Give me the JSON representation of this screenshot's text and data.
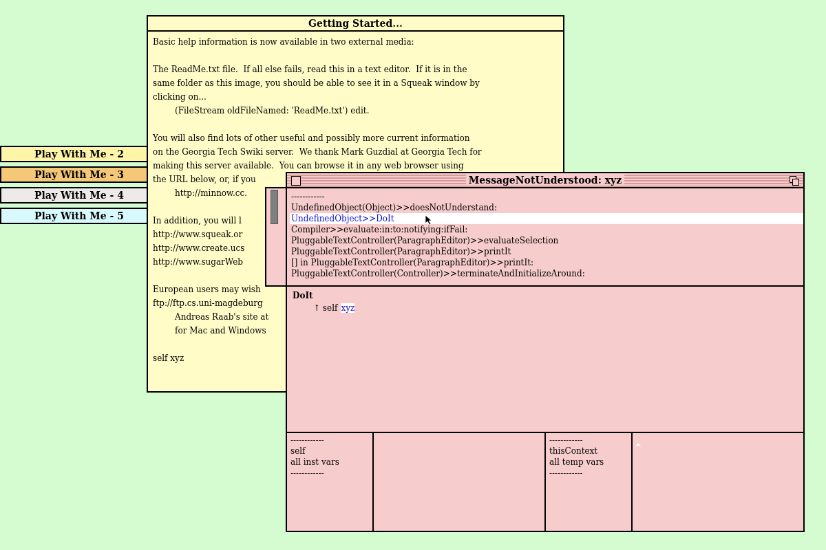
{
  "collapsed_windows": [
    {
      "title": "Play With Me - 2",
      "color": "#fff5a8"
    },
    {
      "title": "Play With Me - 3",
      "color": "#f5c878"
    },
    {
      "title": "Play With Me - 4",
      "color": "#eeeaea"
    },
    {
      "title": "Play With Me - 5",
      "color": "#d8fafe"
    }
  ],
  "help_window": {
    "title": "Getting Started...",
    "paragraphs": [
      {
        "lines": [
          {
            "text": "Basic help information is now available in two external media:",
            "indented": false
          }
        ]
      },
      {
        "lines": [
          {
            "text": "The ReadMe.txt file.  If all else fails, read this in a text editor.  If it is in the",
            "indented": false
          },
          {
            "text": "same folder as this image, you should be able to see it in a Squeak window by",
            "indented": false
          },
          {
            "text": "clicking on...",
            "indented": false
          },
          {
            "text": "(FileStream oldFileNamed: 'ReadMe.txt') edit.",
            "indented": true
          }
        ]
      },
      {
        "lines": [
          {
            "text": "You will also find lots of other useful and possibly more current information",
            "indented": false
          },
          {
            "text": "on the Georgia Tech Swiki server.  We thank Mark Guzdial at Georgia Tech for",
            "indented": false
          },
          {
            "text": "making this server available.  You can browse it in any web browser using",
            "indented": false
          },
          {
            "text": "the URL below, or, if you",
            "indented": false
          },
          {
            "text": "http://minnow.cc.",
            "indented": true
          }
        ]
      },
      {
        "lines": [
          {
            "text": "In addition, you will l",
            "indented": false
          },
          {
            "text": "http://www.squeak.or",
            "indented": false
          },
          {
            "text": "http://www.create.ucs",
            "indented": false
          },
          {
            "text": "http://www.sugarWeb",
            "indented": false
          }
        ]
      },
      {
        "lines": [
          {
            "text": "European users may wish",
            "indented": false
          },
          {
            "text": "ftp://ftp.cs.uni-magdeburg",
            "indented": false
          },
          {
            "text": "Andreas Raab's site at",
            "indented": true
          },
          {
            "text": "for Mac and Windows",
            "indented": true
          }
        ]
      },
      {
        "lines": [
          {
            "text": "self xyz",
            "indented": false
          }
        ]
      }
    ]
  },
  "debugger": {
    "title": "MessageNotUnderstood: xyz",
    "stack": [
      {
        "text": "------------",
        "selected": false
      },
      {
        "text": "UndefinedObject(Object)>>doesNotUnderstand:",
        "selected": false
      },
      {
        "text": "UndefinedObject>>DoIt",
        "selected": true
      },
      {
        "text": "Compiler>>evaluate:in:to:notifying:ifFail:",
        "selected": false
      },
      {
        "text": "PluggableTextController(ParagraphEditor)>>evaluateSelection",
        "selected": false
      },
      {
        "text": "PluggableTextController(ParagraphEditor)>>printIt",
        "selected": false
      },
      {
        "text": "[] in PluggableTextController(ParagraphEditor)>>printIt:",
        "selected": false
      },
      {
        "text": "PluggableTextController(Controller)>>terminateAndInitializeAround:",
        "selected": false
      }
    ],
    "code": {
      "method": "DoIt",
      "statement": "↑ self",
      "selection": "xyz"
    },
    "receiver_fields": [
      "------------",
      "self",
      "all inst vars",
      "------------"
    ],
    "context_fields": [
      "------------",
      "thisContext",
      "all temp vars",
      "------------"
    ]
  }
}
